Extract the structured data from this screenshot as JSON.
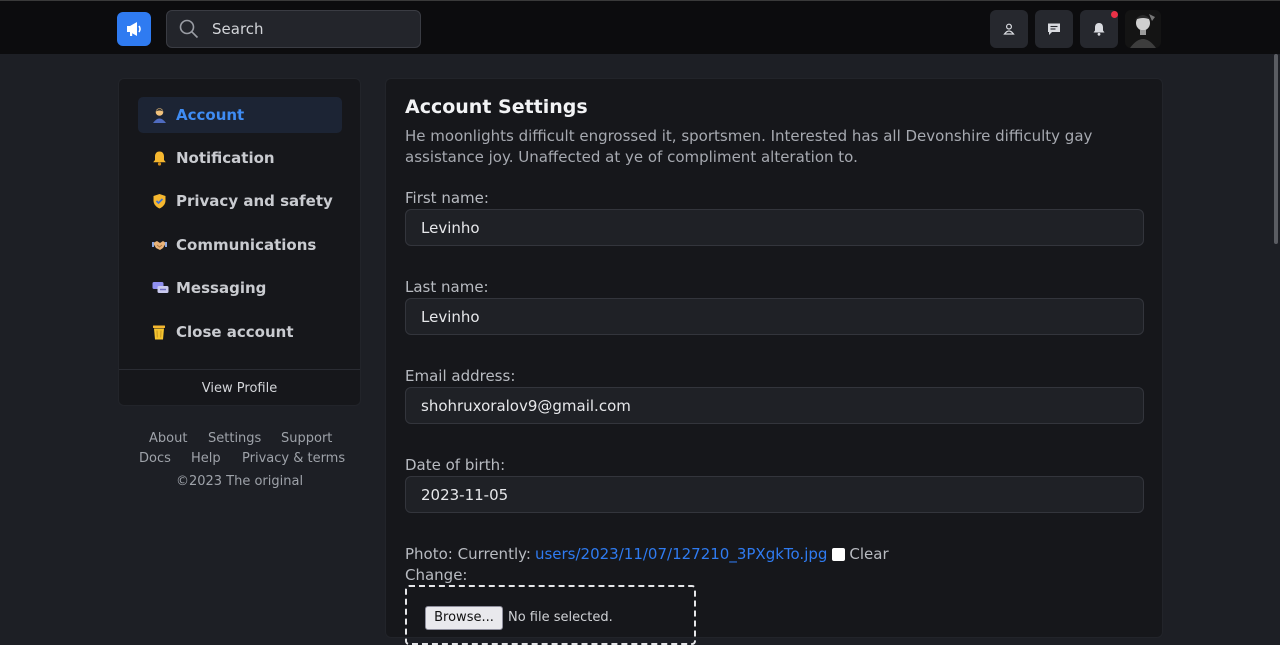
{
  "header": {
    "logo_icon": "megaphone-icon",
    "search_placeholder": "Search",
    "accent": "#2f7bf1",
    "notification_dot_color": "#ea3147",
    "actions": [
      "user-icon",
      "message-icon",
      "bell-icon"
    ]
  },
  "sidebar": {
    "items": [
      {
        "label": "Account",
        "icon": "person-icon",
        "active": true
      },
      {
        "label": "Notification",
        "icon": "bell-icon",
        "active": false
      },
      {
        "label": "Privacy and safety",
        "icon": "shield-icon",
        "active": false
      },
      {
        "label": "Communications",
        "icon": "handshake-icon",
        "active": false
      },
      {
        "label": "Messaging",
        "icon": "chat-icon",
        "active": false
      },
      {
        "label": "Close account",
        "icon": "trash-icon",
        "active": false
      }
    ],
    "view_profile": "View Profile"
  },
  "footer": {
    "links_row1": [
      "About",
      "Settings",
      "Support"
    ],
    "links_row2": [
      "Docs",
      "Help",
      "Privacy & terms"
    ],
    "copyright": "©2023 The original"
  },
  "main": {
    "title": "Account Settings",
    "description": "He moonlights difficult engrossed it, sportsmen. Interested has all Devonshire difficulty gay assistance joy. Unaffected at ye of compliment alteration to.",
    "fields": [
      {
        "label": "First name:",
        "value": "Levinho"
      },
      {
        "label": "Last name:",
        "value": "Levinho"
      },
      {
        "label": "Email address:",
        "value": "shohruxoralov9@gmail.com"
      },
      {
        "label": "Date of birth:",
        "value": "2023-11-05"
      }
    ],
    "photo": {
      "label": "Photo: Currently:",
      "current_file": "users/2023/11/07/127210_3PXgkTo.jpg",
      "clear_label": "Clear",
      "change_label": "Change:",
      "browse_label": "Browse...",
      "no_file_label": "No file selected."
    }
  }
}
